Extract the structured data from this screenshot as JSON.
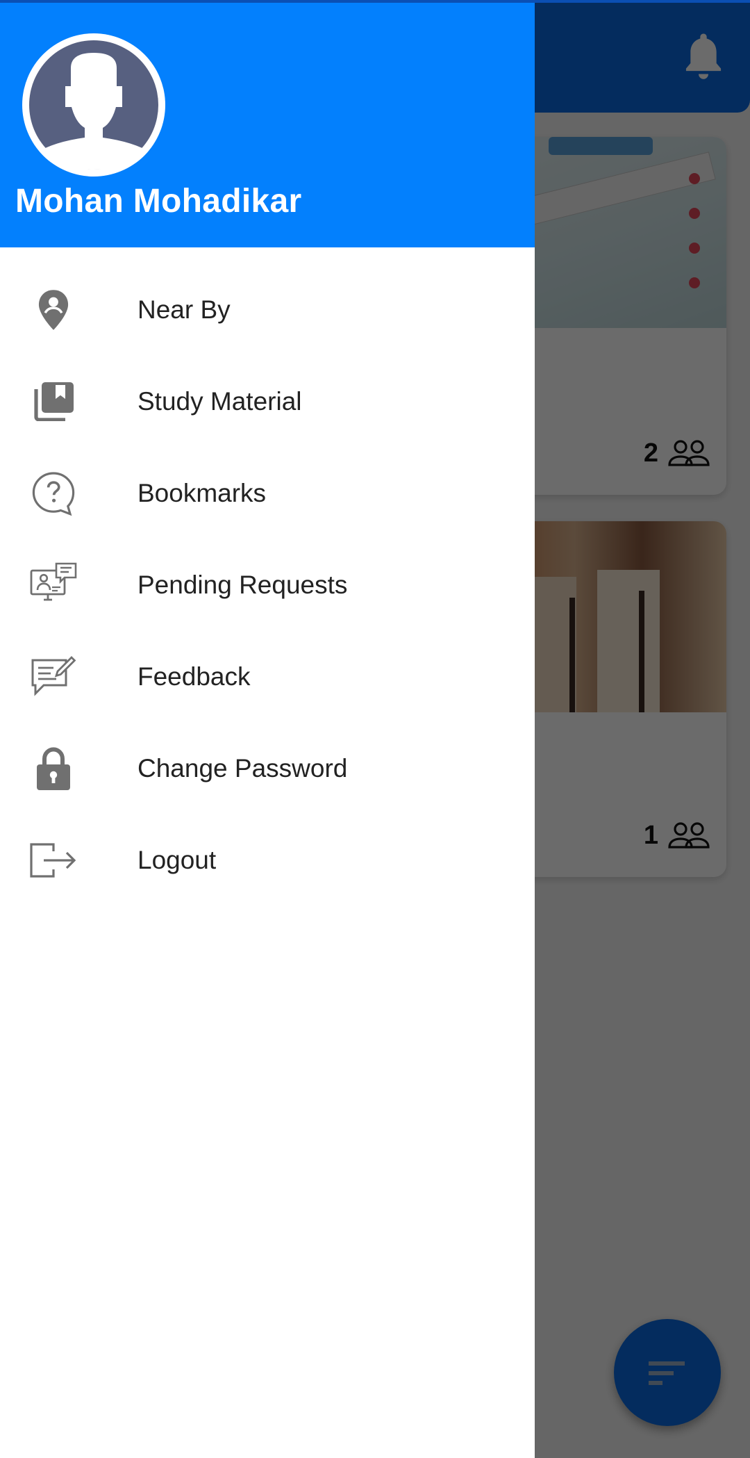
{
  "background_app": {
    "cards": [
      {
        "member_count": "2"
      },
      {
        "member_count": "1"
      }
    ]
  },
  "drawer": {
    "user": {
      "name": "Mohan Mohadikar"
    },
    "menu": [
      {
        "label": "Near By",
        "icon": "location-pin-icon"
      },
      {
        "label": "Study Material",
        "icon": "book-library-icon"
      },
      {
        "label": "Bookmarks",
        "icon": "question-bubble-icon"
      },
      {
        "label": "Pending Requests",
        "icon": "online-tutor-icon"
      },
      {
        "label": "Feedback",
        "icon": "feedback-icon"
      },
      {
        "label": "Change Password",
        "icon": "lock-icon"
      },
      {
        "label": "Logout",
        "icon": "logout-icon"
      }
    ]
  },
  "colors": {
    "drawer_header": "#0380fd",
    "app_primary": "#0a6ae0",
    "icon_gray": "#707070"
  }
}
